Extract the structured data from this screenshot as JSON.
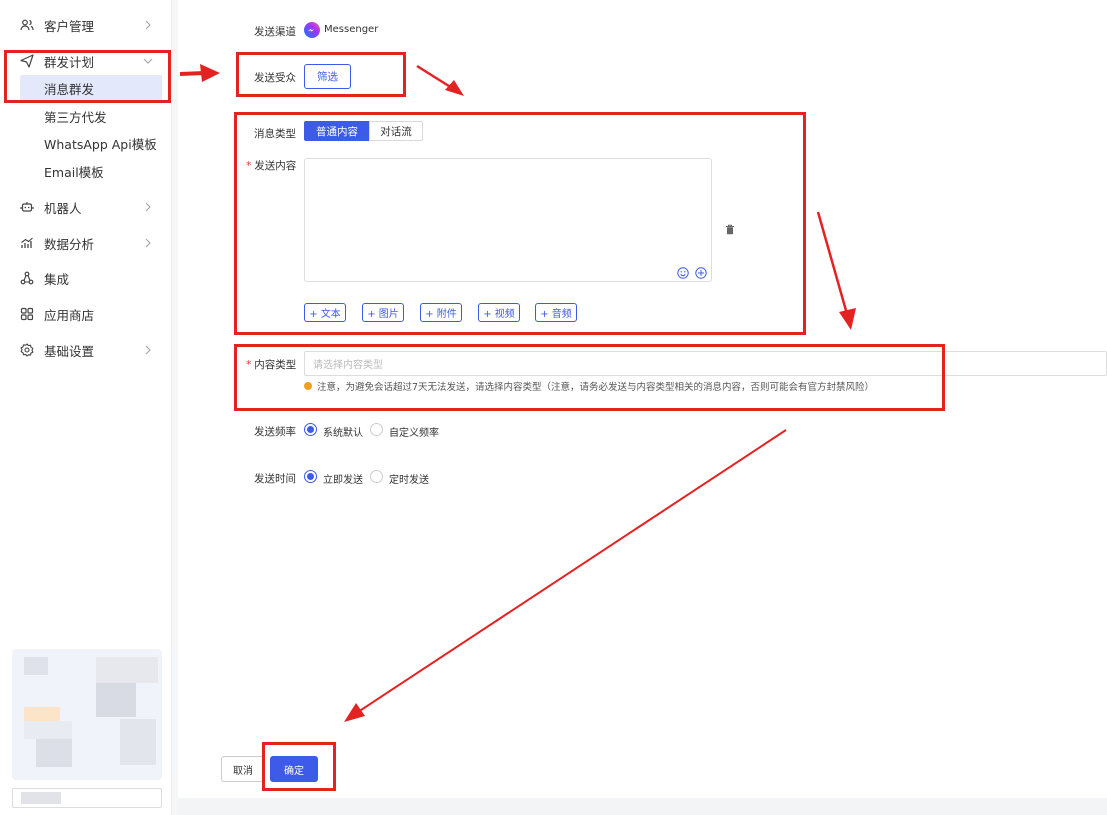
{
  "sidebar": {
    "items": [
      {
        "label": "客户管理",
        "icon": "users-icon"
      },
      {
        "label": "群发计划",
        "icon": "send-icon"
      },
      {
        "label": "机器人",
        "icon": "robot-icon"
      },
      {
        "label": "数据分析",
        "icon": "chart-icon"
      },
      {
        "label": "集成",
        "icon": "integration-icon"
      },
      {
        "label": "应用商店",
        "icon": "app-store-icon"
      },
      {
        "label": "基础设置",
        "icon": "gear-icon"
      }
    ],
    "subitems": [
      "消息群发",
      "第三方代发",
      "WhatsApp Api模板",
      "Email模板"
    ]
  },
  "form": {
    "channel_label": "发送渠道",
    "channel_value": "Messenger",
    "audience_label": "发送受众",
    "audience_button": "筛选",
    "msg_type_label": "消息类型",
    "msg_type_options": [
      "普通内容",
      "对话流"
    ],
    "content_label": "发送内容",
    "add_buttons": [
      "+ 文本",
      "+ 图片",
      "+ 附件",
      "+ 视频",
      "+ 音频"
    ],
    "content_type_label": "内容类型",
    "content_type_placeholder": "请选择内容类型",
    "content_type_note": "注意，为避免会话超过7天无法发送，请选择内容类型（注意，请务必发送与内容类型相关的消息内容，否则可能会有官方封禁风险）",
    "freq_label": "发送频率",
    "freq_options": [
      "系统默认",
      "自定义频率"
    ],
    "time_label": "发送时间",
    "time_options": [
      "立即发送",
      "定时发送"
    ],
    "cancel": "取消",
    "confirm": "确定"
  },
  "colors": {
    "accent": "#3d5be8",
    "annotation": "#e52222",
    "active_bg": "#e3e8fb"
  }
}
